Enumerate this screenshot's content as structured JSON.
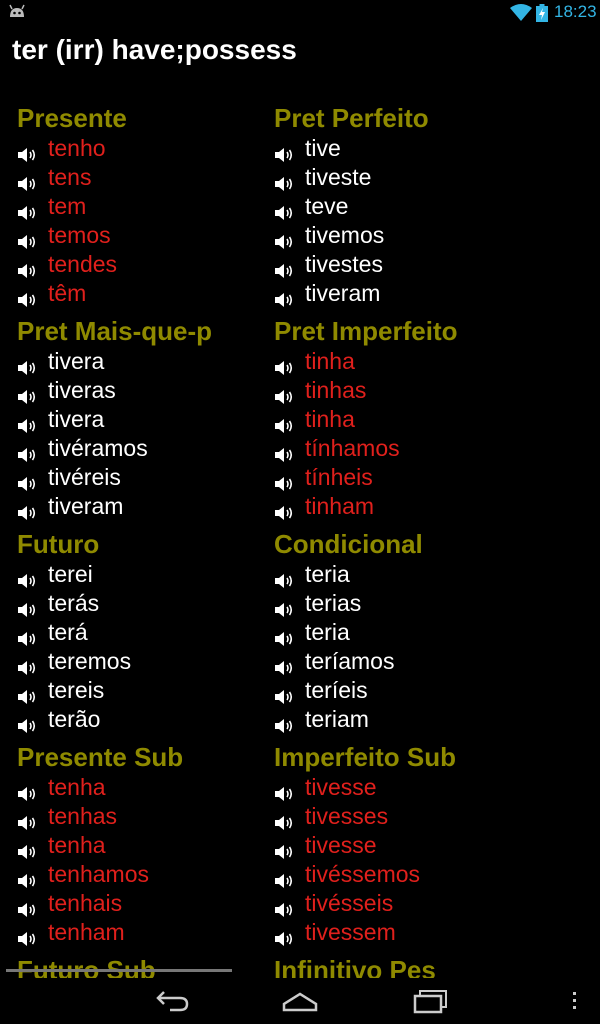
{
  "status_bar": {
    "time": "18:23",
    "icons": [
      "android-icon",
      "wifi-icon",
      "battery-charging-icon"
    ]
  },
  "title": "ter (irr) have;possess",
  "colors": {
    "section_header": "#8f8a00",
    "irregular_form": "#e0201c",
    "regular_form": "#ffffff",
    "clock": "#33b5e5"
  },
  "sections": [
    {
      "name": "Presente",
      "forms": [
        {
          "text": "tenho",
          "irregular": true
        },
        {
          "text": "tens",
          "irregular": true
        },
        {
          "text": "tem",
          "irregular": true
        },
        {
          "text": "temos",
          "irregular": true
        },
        {
          "text": "tendes",
          "irregular": true
        },
        {
          "text": "têm",
          "irregular": true
        }
      ]
    },
    {
      "name": "Pret Perfeito",
      "forms": [
        {
          "text": "tive",
          "irregular": false
        },
        {
          "text": "tiveste",
          "irregular": false
        },
        {
          "text": "teve",
          "irregular": false
        },
        {
          "text": "tivemos",
          "irregular": false
        },
        {
          "text": "tivestes",
          "irregular": false
        },
        {
          "text": "tiveram",
          "irregular": false
        }
      ]
    },
    {
      "name": "Pret Mais-que-p",
      "forms": [
        {
          "text": "tivera",
          "irregular": false
        },
        {
          "text": "tiveras",
          "irregular": false
        },
        {
          "text": "tivera",
          "irregular": false
        },
        {
          "text": "tivéramos",
          "irregular": false
        },
        {
          "text": "tivéreis",
          "irregular": false
        },
        {
          "text": "tiveram",
          "irregular": false
        }
      ]
    },
    {
      "name": "Pret Imperfeito",
      "forms": [
        {
          "text": "tinha",
          "irregular": true
        },
        {
          "text": "tinhas",
          "irregular": true
        },
        {
          "text": "tinha",
          "irregular": true
        },
        {
          "text": "tínhamos",
          "irregular": true
        },
        {
          "text": "tínheis",
          "irregular": true
        },
        {
          "text": "tinham",
          "irregular": true
        }
      ]
    },
    {
      "name": "Futuro",
      "forms": [
        {
          "text": "terei",
          "irregular": false
        },
        {
          "text": "terás",
          "irregular": false
        },
        {
          "text": "terá",
          "irregular": false
        },
        {
          "text": "teremos",
          "irregular": false
        },
        {
          "text": "tereis",
          "irregular": false
        },
        {
          "text": "terão",
          "irregular": false
        }
      ]
    },
    {
      "name": "Condicional",
      "forms": [
        {
          "text": "teria",
          "irregular": false
        },
        {
          "text": "terias",
          "irregular": false
        },
        {
          "text": "teria",
          "irregular": false
        },
        {
          "text": "teríamos",
          "irregular": false
        },
        {
          "text": "teríeis",
          "irregular": false
        },
        {
          "text": "teriam",
          "irregular": false
        }
      ]
    },
    {
      "name": "Presente Sub",
      "forms": [
        {
          "text": "tenha",
          "irregular": true
        },
        {
          "text": "tenhas",
          "irregular": true
        },
        {
          "text": "tenha",
          "irregular": true
        },
        {
          "text": "tenhamos",
          "irregular": true
        },
        {
          "text": "tenhais",
          "irregular": true
        },
        {
          "text": "tenham",
          "irregular": true
        }
      ]
    },
    {
      "name": "Imperfeito Sub",
      "forms": [
        {
          "text": "tivesse",
          "irregular": true
        },
        {
          "text": "tivesses",
          "irregular": true
        },
        {
          "text": "tivesse",
          "irregular": true
        },
        {
          "text": "tivéssemos",
          "irregular": true
        },
        {
          "text": "tivésseis",
          "irregular": true
        },
        {
          "text": "tivessem",
          "irregular": true
        }
      ]
    },
    {
      "name": "Futuro Sub",
      "forms": []
    },
    {
      "name": "Infinitivo Pes",
      "forms": []
    }
  ],
  "nav_bar": [
    "back-icon",
    "home-icon",
    "recent-apps-icon",
    "overflow-menu-icon"
  ]
}
